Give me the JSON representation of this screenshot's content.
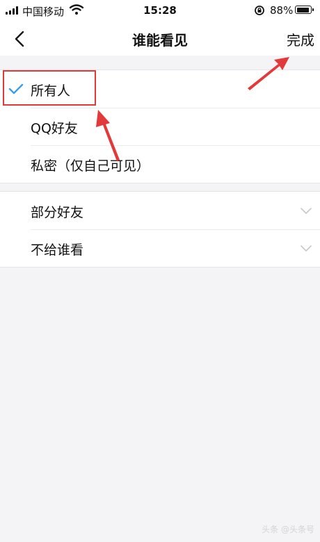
{
  "status_bar": {
    "carrier": "中国移动",
    "time": "15:28",
    "battery": "88%",
    "battery_level": 0.88
  },
  "nav": {
    "title": "谁能看见",
    "done_label": "完成"
  },
  "visibility_options": [
    {
      "label": "所有人",
      "selected": true
    },
    {
      "label": "QQ好友",
      "selected": false
    },
    {
      "label": "私密（仅自己可见）",
      "selected": false
    }
  ],
  "partial_options": [
    {
      "label": "部分好友"
    },
    {
      "label": "不给谁看"
    }
  ],
  "watermark": "头条 @头条号",
  "colors": {
    "accent": "#3a9fe8",
    "annotation": "#e23a3a",
    "background": "#f4f4f6"
  },
  "icons": {
    "back": "chevron-left-icon",
    "check": "checkmark-icon",
    "expand": "chevron-down-icon",
    "wifi": "wifi-icon",
    "lock": "rotation-lock-icon"
  }
}
